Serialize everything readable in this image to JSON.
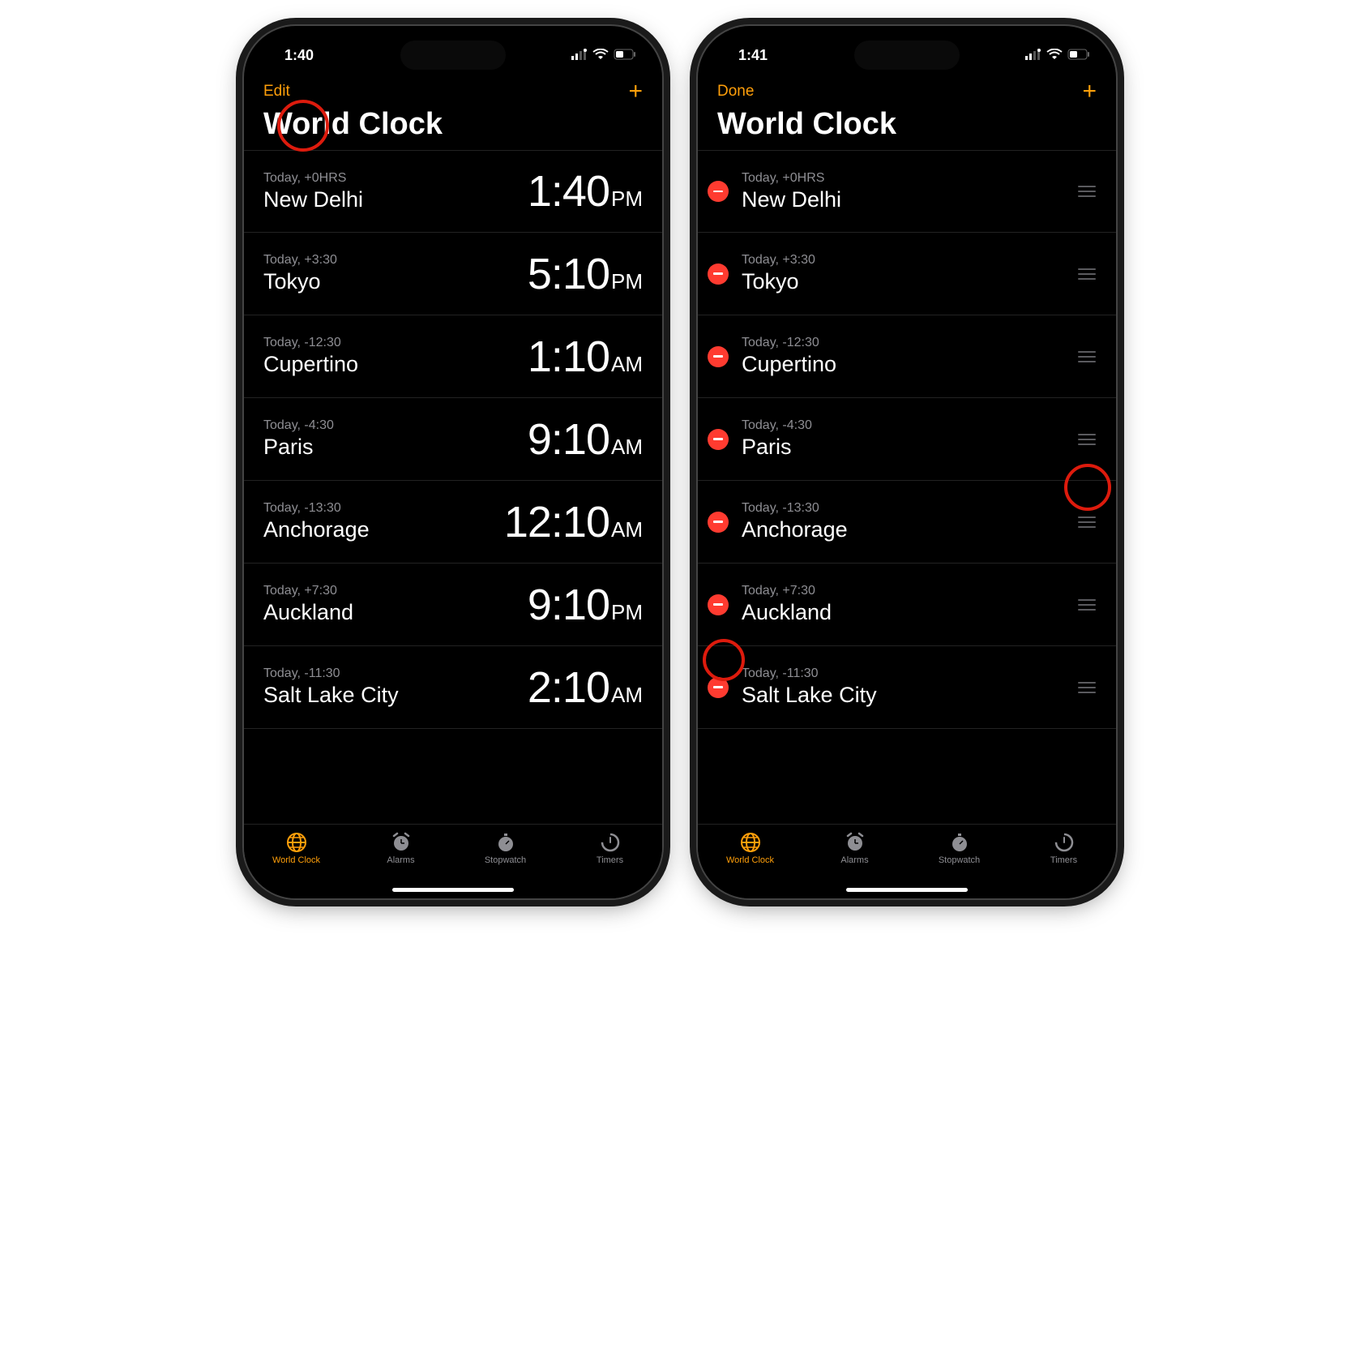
{
  "left_phone": {
    "status_time": "1:40",
    "nav_left": "Edit",
    "title": "World Clock",
    "rows": [
      {
        "sub": "Today, +0HRS",
        "city": "New Delhi",
        "time": "1:40",
        "ampm": "PM"
      },
      {
        "sub": "Today, +3:30",
        "city": "Tokyo",
        "time": "5:10",
        "ampm": "PM"
      },
      {
        "sub": "Today, -12:30",
        "city": "Cupertino",
        "time": "1:10",
        "ampm": "AM"
      },
      {
        "sub": "Today, -4:30",
        "city": "Paris",
        "time": "9:10",
        "ampm": "AM"
      },
      {
        "sub": "Today, -13:30",
        "city": "Anchorage",
        "time": "12:10",
        "ampm": "AM"
      },
      {
        "sub": "Today, +7:30",
        "city": "Auckland",
        "time": "9:10",
        "ampm": "PM"
      },
      {
        "sub": "Today, -11:30",
        "city": "Salt Lake City",
        "time": "2:10",
        "ampm": "AM"
      }
    ]
  },
  "right_phone": {
    "status_time": "1:41",
    "nav_left": "Done",
    "title": "World Clock",
    "rows": [
      {
        "sub": "Today, +0HRS",
        "city": "New Delhi"
      },
      {
        "sub": "Today, +3:30",
        "city": "Tokyo"
      },
      {
        "sub": "Today, -12:30",
        "city": "Cupertino"
      },
      {
        "sub": "Today, -4:30",
        "city": "Paris"
      },
      {
        "sub": "Today, -13:30",
        "city": "Anchorage"
      },
      {
        "sub": "Today, +7:30",
        "city": "Auckland"
      },
      {
        "sub": "Today, -11:30",
        "city": "Salt Lake City"
      }
    ]
  },
  "tabs": [
    {
      "label": "World Clock",
      "icon": "globe"
    },
    {
      "label": "Alarms",
      "icon": "alarm"
    },
    {
      "label": "Stopwatch",
      "icon": "stopwatch"
    },
    {
      "label": "Timers",
      "icon": "timer"
    }
  ],
  "colors": {
    "accent": "#ff9f0a",
    "delete": "#ff3b30",
    "highlight": "#dd1b0d"
  }
}
